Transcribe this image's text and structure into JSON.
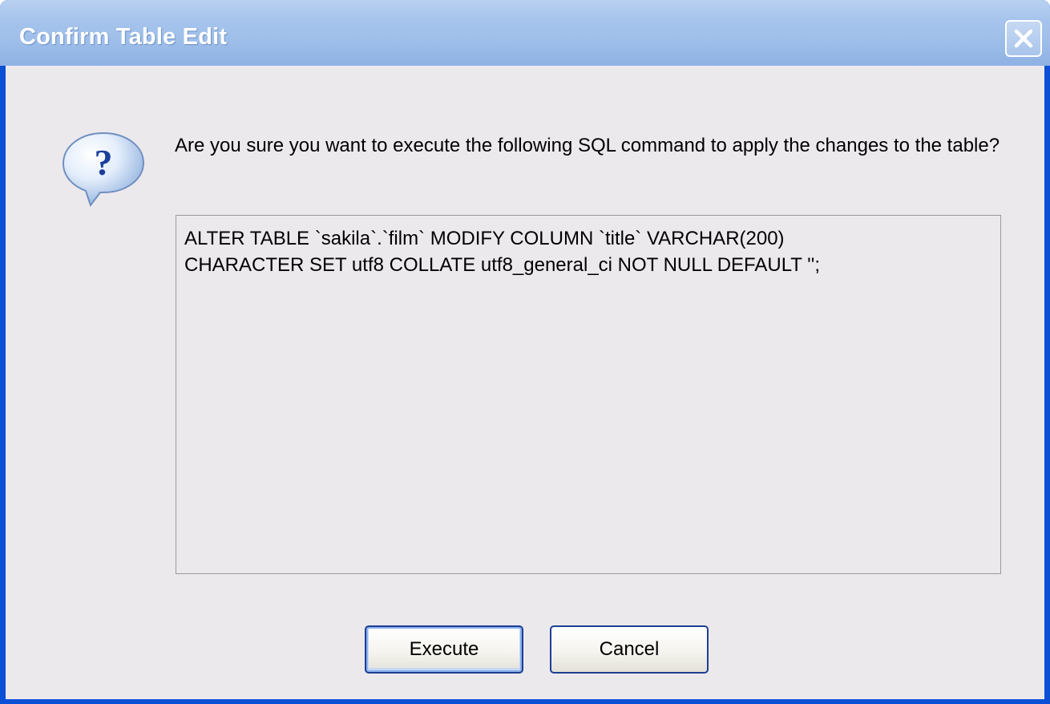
{
  "dialog": {
    "title": "Confirm Table Edit",
    "message": "Are you sure you want to execute the following SQL command to apply the changes to the table?",
    "sql": "ALTER TABLE `sakila`.`film` MODIFY COLUMN `title` VARCHAR(200)\nCHARACTER SET utf8 COLLATE utf8_general_ci NOT NULL DEFAULT '';",
    "buttons": {
      "execute_label": "Execute",
      "cancel_label": "Cancel"
    },
    "icons": {
      "message_icon": "question-icon",
      "close_icon": "close-icon"
    }
  }
}
